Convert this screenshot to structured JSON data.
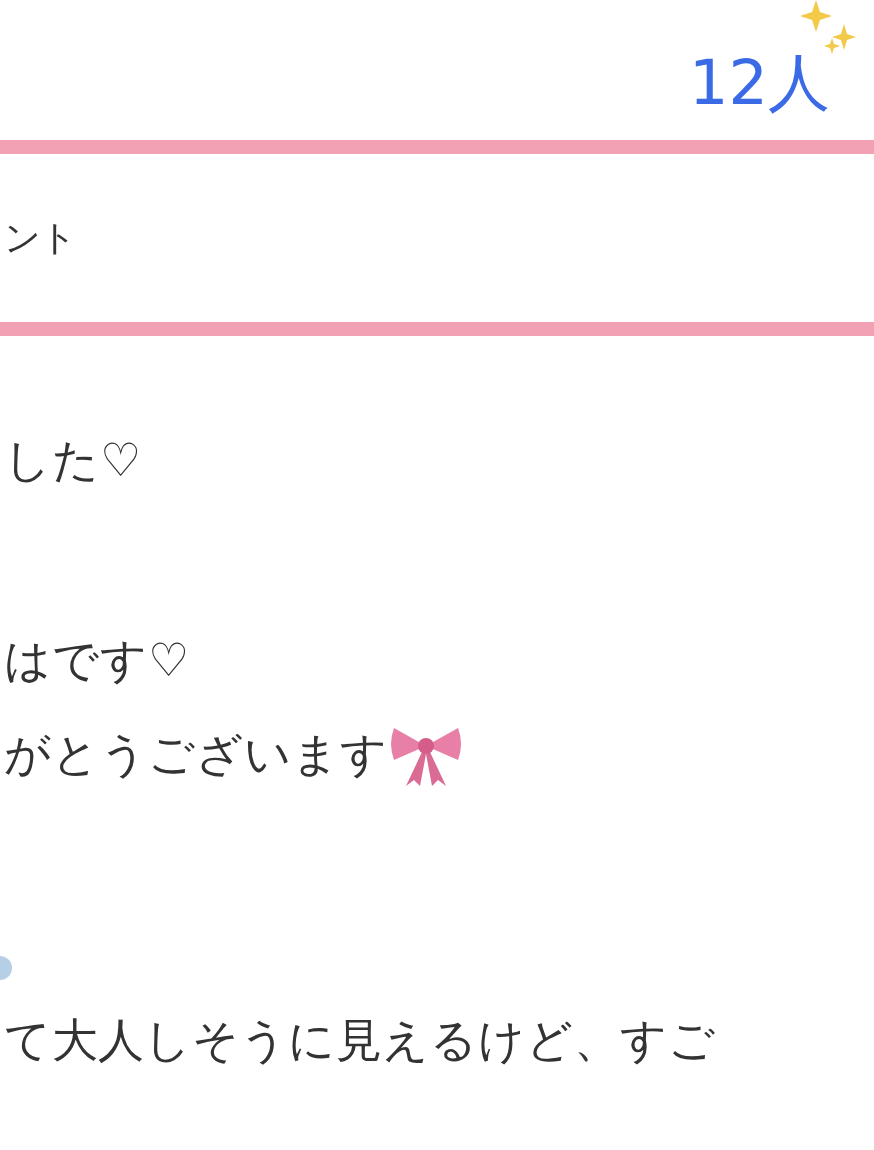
{
  "header": {
    "count": "12人"
  },
  "section": {
    "label": "ント"
  },
  "lines": [
    {
      "text": "した♡",
      "kind": "plain"
    },
    {
      "text": "はです♡",
      "kind": "plain"
    },
    {
      "text": "がとうございます",
      "kind": "bow"
    },
    {
      "text": "て大人しそうに見えるけど、すご",
      "kind": "plain"
    }
  ]
}
